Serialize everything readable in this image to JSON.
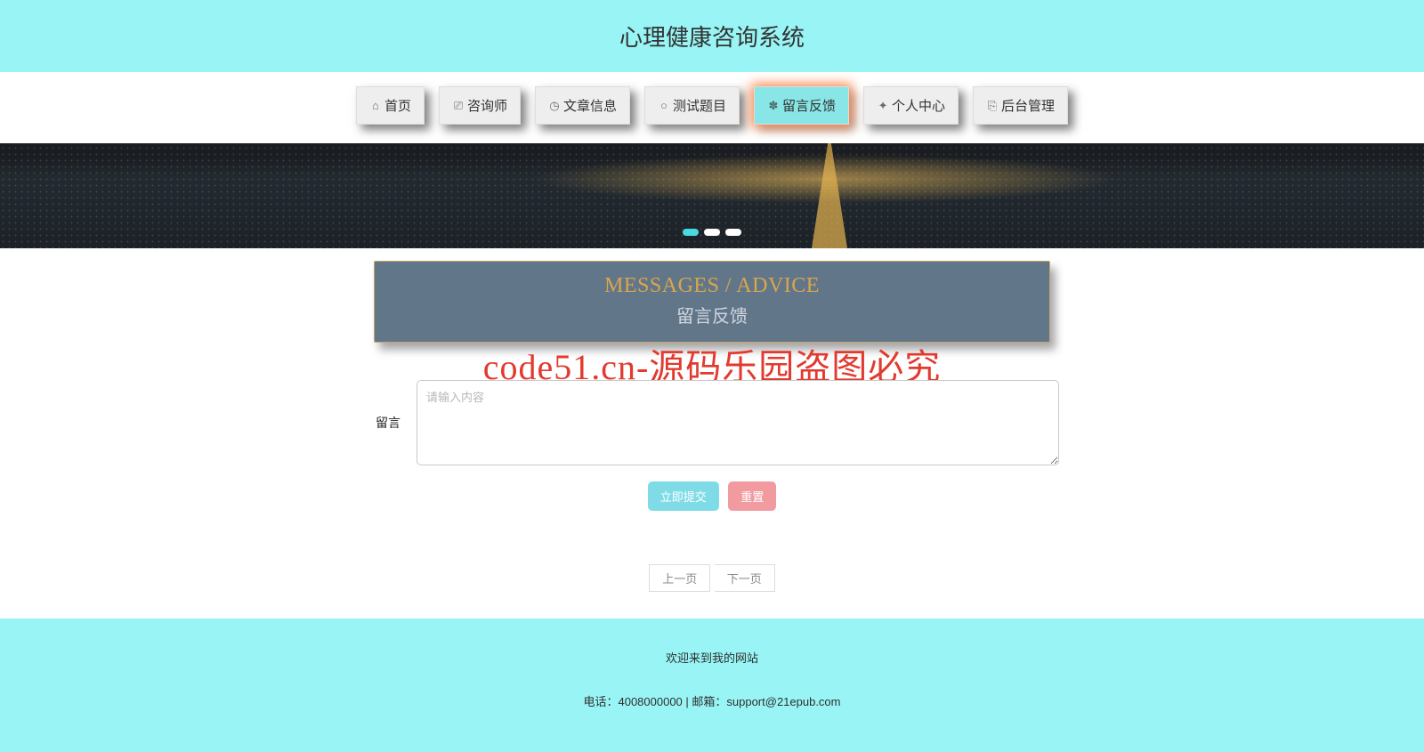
{
  "header": {
    "title": "心理健康咨询系统"
  },
  "nav": {
    "items": [
      {
        "label": "首页",
        "icon": "⌂",
        "name": "nav-home"
      },
      {
        "label": "咨询师",
        "icon": "⎚",
        "name": "nav-counselor"
      },
      {
        "label": "文章信息",
        "icon": "◷",
        "name": "nav-articles"
      },
      {
        "label": "测试题目",
        "icon": "○",
        "name": "nav-tests"
      },
      {
        "label": "留言反馈",
        "icon": "✽",
        "name": "nav-feedback"
      },
      {
        "label": "个人中心",
        "icon": "✦",
        "name": "nav-profile"
      },
      {
        "label": "后台管理",
        "icon": "⎘",
        "name": "nav-admin"
      }
    ],
    "activeIndex": 4
  },
  "sectionTitle": {
    "en": "MESSAGES / ADVICE",
    "cn": "留言反馈"
  },
  "watermark": "code51.cn-源码乐园盗图必究",
  "form": {
    "label": "留言",
    "placeholder": "请输入内容",
    "submit": "立即提交",
    "reset": "重置"
  },
  "pager": {
    "prev": "上一页",
    "next": "下一页"
  },
  "footer": {
    "line1": "欢迎来到我的网站",
    "line2": "电话：4008000000 | 邮箱：support@21epub.com"
  }
}
